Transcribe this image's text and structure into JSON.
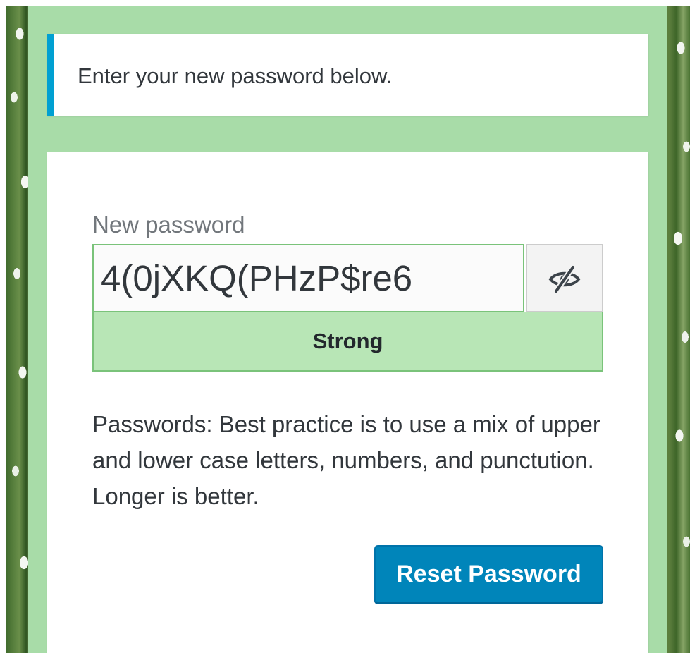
{
  "message": {
    "text": "Enter your new password below.",
    "accent_color": "#00a0d2"
  },
  "form": {
    "label": "New password",
    "password_value": "4(0jXKQ(PHzP$re6",
    "visibility_toggle_icon": "eye-slash-icon",
    "strength": "Strong",
    "strength_color": "#b8e6b6",
    "hint": "Passwords: Best practice is to use a mix of upper and lower case letters, numbers, and punctution. Longer is better.",
    "submit_label": "Reset Password",
    "submit_color": "#0085ba"
  },
  "theme": {
    "column_background": "#a8dca8"
  }
}
